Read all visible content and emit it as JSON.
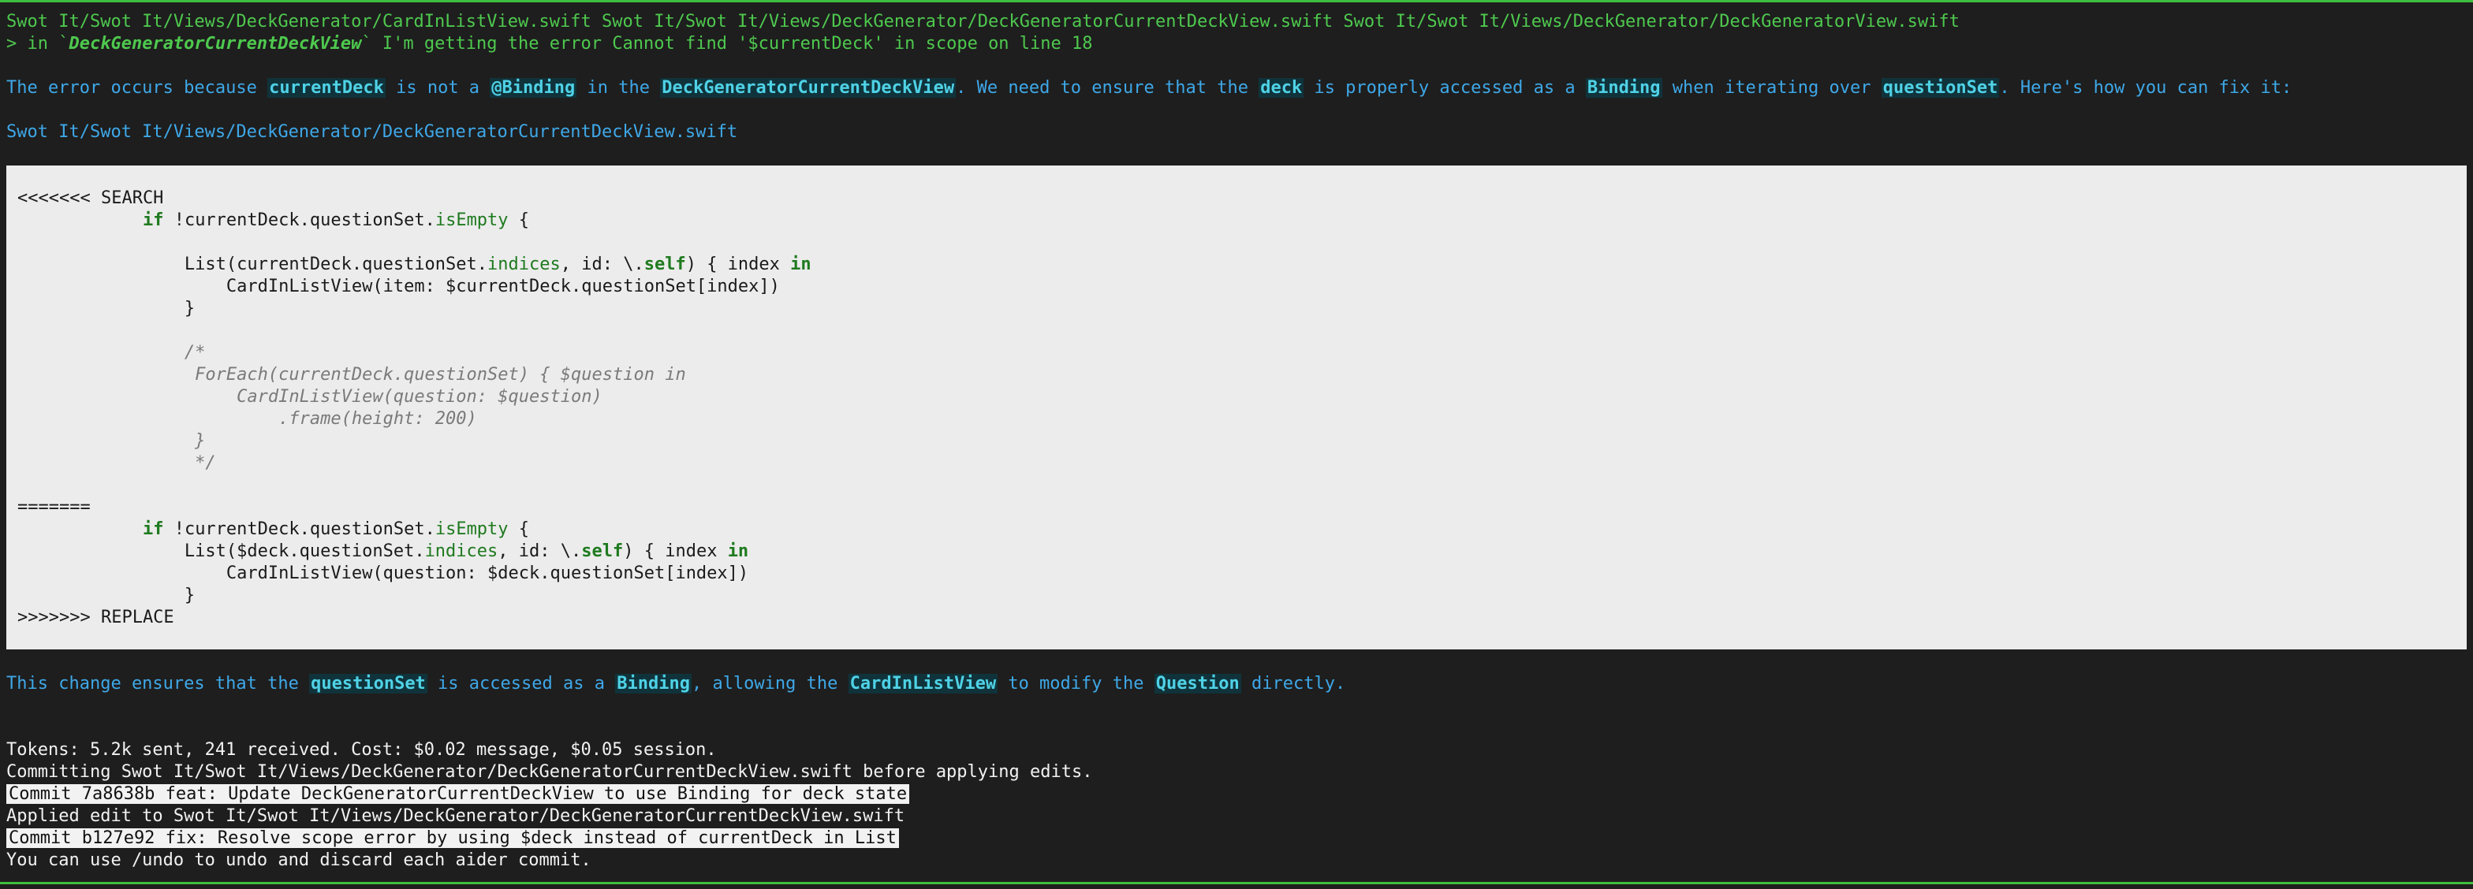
{
  "colors": {
    "background": "#1e1e1e",
    "rule": "#3fbf3f",
    "prompt_green": "#4ec94e",
    "assistant_blue": "#3ea8e8",
    "highlight_text": "#4fd2e6",
    "code_background": "#ececec"
  },
  "header": {
    "files_line": "Swot It/Swot It/Views/DeckGenerator/CardInListView.swift Swot It/Swot It/Views/DeckGenerator/DeckGeneratorCurrentDeckView.swift Swot It/Swot It/Views/DeckGenerator/DeckGeneratorView.swift",
    "prompt_prefix": "> in `",
    "prompt_file": "DeckGeneratorCurrentDeckView",
    "prompt_suffix": "` I'm getting the error Cannot find '$currentDeck' in scope on line 18"
  },
  "reply": {
    "p1": [
      "The error occurs because ",
      "currentDeck",
      " is not a ",
      "@Binding",
      " in the ",
      "DeckGeneratorCurrentDeckView",
      ". We need to ensure that the ",
      "deck",
      " is properly accessed as a ",
      "Binding",
      " when iterating over ",
      "questionSet",
      ". Here's how you can fix it:"
    ],
    "file_path": "Swot It/Swot It/Views/DeckGenerator/DeckGeneratorCurrentDeckView.swift",
    "p2": [
      "This change ensures that the ",
      "questionSet",
      " is accessed as a ",
      "Binding",
      ", allowing the ",
      "CardInListView",
      " to modify the ",
      "Question",
      " directly."
    ]
  },
  "code": {
    "search_marker": "<<<<<<< SEARCH",
    "s_if_kw": "if",
    "s_if_mid": " !currentDeck.questionSet.",
    "s_if_fn": "isEmpty",
    "s_if_end": " {",
    "s_list_a": "List(currentDeck.questionSet.",
    "s_list_fn": "indices",
    "s_list_b": ", id: \\.",
    "s_list_self": "self",
    "s_list_c": ") { index ",
    "s_list_in": "in",
    "s_card": "CardInListView(item: $currentDeck.questionSet[index])",
    "s_close": "}",
    "c1": "/*",
    "c2": " ForEach(currentDeck.questionSet) { $question in",
    "c3": "     CardInListView(question: $question)",
    "c4": "         .frame(height: 200)",
    "c5": " }",
    "c6": " */",
    "divider": "=======",
    "r_if_kw": "if",
    "r_if_mid": " !currentDeck.questionSet.",
    "r_if_fn": "isEmpty",
    "r_if_end": " {",
    "r_list_a": "List($deck.questionSet.",
    "r_list_fn": "indices",
    "r_list_b": ", id: \\.",
    "r_list_self": "self",
    "r_list_c": ") { index ",
    "r_list_in": "in",
    "r_card": "CardInListView(question: $deck.questionSet[index])",
    "r_close": "}",
    "replace_marker": ">>>>>>> REPLACE"
  },
  "status": {
    "tokens": "Tokens: 5.2k sent, 241 received. Cost: $0.02 message, $0.05 session.",
    "committing": "Committing Swot It/Swot It/Views/DeckGenerator/DeckGeneratorCurrentDeckView.swift before applying edits.",
    "commit1": "Commit 7a8638b feat: Update DeckGeneratorCurrentDeckView to use Binding for deck state",
    "applied": "Applied edit to Swot It/Swot It/Views/DeckGenerator/DeckGeneratorCurrentDeckView.swift",
    "commit2": "Commit b127e92 fix: Resolve scope error by using $deck instead of currentDeck in List",
    "undo": "You can use /undo to undo and discard each aider commit."
  }
}
